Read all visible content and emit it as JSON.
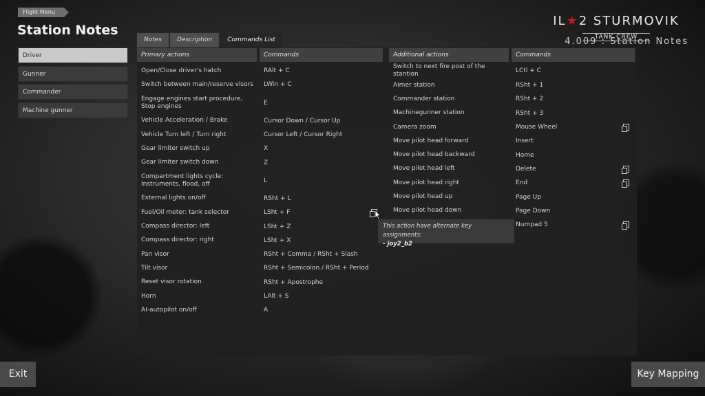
{
  "header": {
    "breadcrumb": "Flight Menu",
    "title": "Station Notes",
    "logo_il": "IL",
    "logo_num": "2 STURMOVIK",
    "logo_sub": "TANK CREW",
    "version": "4.009 : Station Notes"
  },
  "sidebar": {
    "items": [
      {
        "label": "Driver",
        "active": true
      },
      {
        "label": "Gunner"
      },
      {
        "label": "Commander"
      },
      {
        "label": "Machine gunner"
      }
    ]
  },
  "tabs": [
    {
      "label": "Notes"
    },
    {
      "label": "Description"
    },
    {
      "label": "Commands List",
      "active": true
    }
  ],
  "primary": {
    "header_action": "Primary actions",
    "header_commands": "Commands",
    "rows": [
      {
        "action": "Open/Close driver's hatch",
        "command": "RAlt + C"
      },
      {
        "action": "Switch between main/reserve visors",
        "command": "LWin + C"
      },
      {
        "action": "Engage engines start procedure, Stop engines",
        "command": "E"
      },
      {
        "action": "Vehicle Acceleration / Brake",
        "command": "Cursor Down / Cursor Up"
      },
      {
        "action": "Vehicle Turn left / Turn right",
        "command": "Cursor Left / Cursor Right"
      },
      {
        "action": "Gear limiter switch up",
        "command": "X"
      },
      {
        "action": "Gear limiter switch down",
        "command": "Z"
      },
      {
        "action": "Compartment lights cycle: Instruments, flood, off",
        "command": "L"
      },
      {
        "action": "External lights on/off",
        "command": "RSht + L"
      },
      {
        "action": "Fuel/Oil meter: tank selector",
        "command": "LSht + F"
      },
      {
        "action": "Compass director: left",
        "command": "LSht + Z"
      },
      {
        "action": "Compass director: right",
        "command": "LSht + X"
      },
      {
        "action": "Pan visor",
        "command": "RSht + Comma / RSht + Slash"
      },
      {
        "action": "Tilt visor",
        "command": "RSht + Semicolon / RSht + Period"
      },
      {
        "action": "Reset visor rotation",
        "command": "RSht + Apostrophe"
      },
      {
        "action": "Horn",
        "command": "LAlt + S"
      },
      {
        "action": "AI-autopilot on/off",
        "command": "A"
      }
    ]
  },
  "additional": {
    "header_action": "Additional actions",
    "header_commands": "Commands",
    "rows": [
      {
        "action": "Switch to next fire post of the stantion",
        "command": "LCtl + C"
      },
      {
        "action": "Aimer station",
        "command": "RSht + 1"
      },
      {
        "action": "Commander station",
        "command": "RSht + 2"
      },
      {
        "action": "Machinegunner station",
        "command": "RSht + 3"
      },
      {
        "action": "Camera zoom",
        "command": "Mouse Wheel"
      },
      {
        "action": "Move pilot head forward",
        "command": "Insert"
      },
      {
        "action": "Move pilot head backward",
        "command": "Home"
      },
      {
        "action": "Move pilot head left",
        "command": "Delete"
      },
      {
        "action": "Move pilot head right",
        "command": "End"
      },
      {
        "action": "Move pilot head up",
        "command": "Page Up"
      },
      {
        "action": "Move pilot head down",
        "command": "Page Down"
      },
      {
        "action": "",
        "command": "Numpad 5"
      }
    ]
  },
  "tooltip": {
    "line1": "This action have alternate key assignments:",
    "line2": "- joy2_b2"
  },
  "buttons": {
    "exit": "Exit",
    "key_mapping": "Key Mapping"
  }
}
